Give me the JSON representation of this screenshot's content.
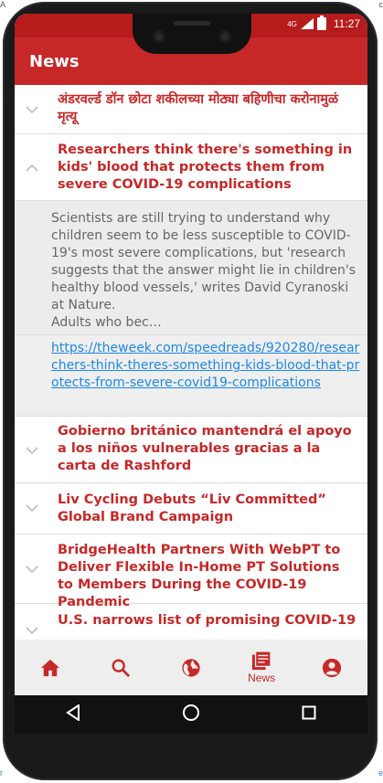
{
  "background": {
    "top_left_fragment": "A",
    "top_right_fragment": "c",
    "bottom_left_fragment": "r",
    "bottom_right_fragment": "e"
  },
  "status_bar": {
    "network_label": "4G",
    "time": "11:27"
  },
  "app_bar": {
    "title": "News"
  },
  "news_items": [
    {
      "title": "अंडरवर्ल्ड डॉन छोटा शकीलच्या मोठ्या बहिणीचा करोनामुळं मृत्यू",
      "expanded": false
    },
    {
      "title": "Researchers think there's something in kids' blood that protects them from severe COVID-19 complications",
      "expanded": true,
      "summary": "Scientists are still trying to understand why children seem to be less susceptible to COVID-19's most severe complications, but 'research suggests that the answer might lie in children's healthy blood vessels,' writes David Cyranoski at Nature.\nAdults who bec…",
      "link": "https://theweek.com/speedreads/920280/researchers-think-theres-something-kids-blood-that-protects-from-severe-covid19-complications"
    },
    {
      "title": "Gobierno británico mantendrá el apoyo a los niños vulnerables gracias a la carta de Rashford",
      "expanded": false
    },
    {
      "title": "Liv Cycling Debuts “Liv Committed” Global Brand Campaign",
      "expanded": false
    },
    {
      "title": "BridgeHealth Partners With WebPT to Deliver Flexible In-Home PT Solutions to Members During the COVID-19 Pandemic",
      "expanded": false
    },
    {
      "title": "U.S. narrows list of promising COVID-19",
      "expanded": false
    }
  ],
  "bottom_nav": {
    "items": [
      {
        "icon": "home-icon",
        "label": ""
      },
      {
        "icon": "search-icon",
        "label": ""
      },
      {
        "icon": "globe-icon",
        "label": ""
      },
      {
        "icon": "news-icon",
        "label": "News"
      },
      {
        "icon": "account-icon",
        "label": ""
      }
    ],
    "active_color": "#c62828"
  },
  "system_nav": {
    "buttons": [
      "back-icon",
      "home-circle-icon",
      "recents-icon"
    ]
  },
  "colors": {
    "accent": "#c62828",
    "status_bar": "#b71c1c",
    "link": "#1e88e5"
  }
}
